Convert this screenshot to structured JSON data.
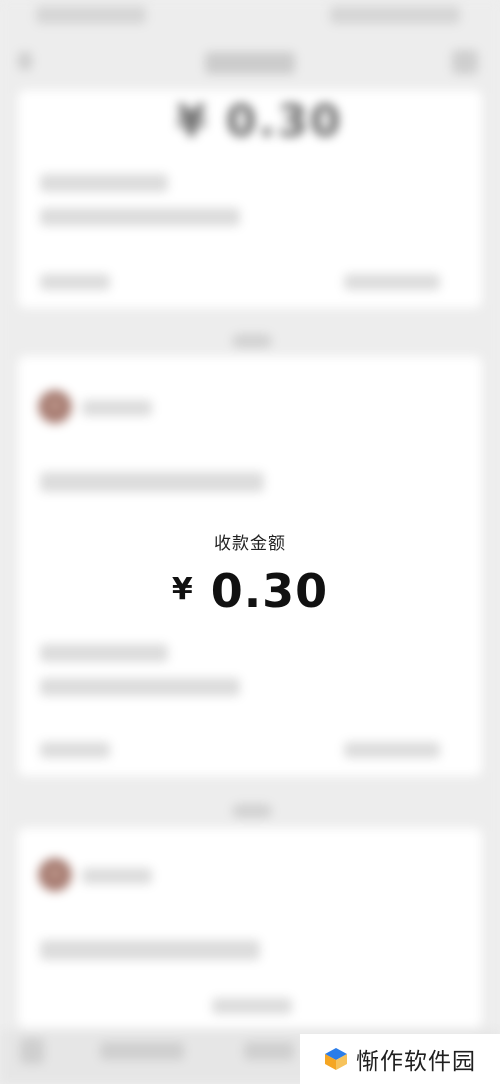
{
  "amount_display": {
    "label": "收款金额",
    "currency_symbol": "¥",
    "value": "0.30"
  },
  "watermark": {
    "text": "惭作软件园",
    "logo_colors": [
      "#f5a623",
      "#2b7de9"
    ]
  }
}
